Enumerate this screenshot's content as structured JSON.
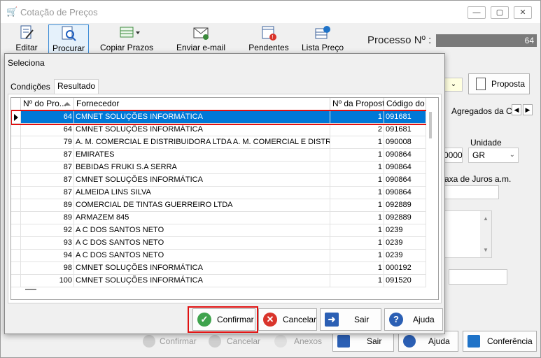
{
  "window": {
    "title": "Cotação de Preços",
    "controls": [
      "—",
      "▢",
      "✕"
    ]
  },
  "toolbar": {
    "buttons": [
      {
        "label": "Editar"
      },
      {
        "label": "Procurar"
      },
      {
        "label": "Copiar Prazos"
      },
      {
        "label": "Enviar e-mail"
      },
      {
        "label": "Pendentes"
      },
      {
        "label": "Lista Preço"
      }
    ],
    "process_label": "Processo Nº :",
    "process_value": "64"
  },
  "background": {
    "proposta_button": "Proposta",
    "agregados_tab": "Agregados da C",
    "unidade_label": "Unidade",
    "num_value": "0000",
    "unidade_value": "GR",
    "juros_label": "axa de Juros a.m.",
    "bottom_buttons": {
      "confirmar": "Confirmar",
      "cancelar": "Cancelar",
      "anexos": "Anexos",
      "sair": "Sair",
      "ajuda": "Ajuda",
      "conferencia": "Conferência"
    }
  },
  "dialog": {
    "title": "Seleciona",
    "tabs": [
      "Condições",
      "Resultado"
    ],
    "active_tab": "Resultado",
    "columns": [
      "Nº do Pro...",
      "Fornecedor",
      "Nº da Proposta",
      "Código do Iter"
    ],
    "rows": [
      {
        "num": "64",
        "fornecedor": "CMNET SOLUÇÕES INFORMÁTICA",
        "proposta": "1",
        "codigo": "091681"
      },
      {
        "num": "64",
        "fornecedor": "CMNET SOLUÇÕES INFORMÁTICA",
        "proposta": "2",
        "codigo": "091681"
      },
      {
        "num": "79",
        "fornecedor": "A. M. COMERCIAL E DISTRIBUIDORA LTDA A. M. COMERCIAL E DISTR",
        "proposta": "1",
        "codigo": "090008"
      },
      {
        "num": "87",
        "fornecedor": "EMIRATES",
        "proposta": "1",
        "codigo": "090864"
      },
      {
        "num": "87",
        "fornecedor": "BEBIDAS FRUKI S.A SERRA",
        "proposta": "1",
        "codigo": "090864"
      },
      {
        "num": "87",
        "fornecedor": "CMNET SOLUÇÕES INFORMÁTICA",
        "proposta": "1",
        "codigo": "090864"
      },
      {
        "num": "87",
        "fornecedor": "ALMEIDA LINS SILVA",
        "proposta": "1",
        "codigo": "090864"
      },
      {
        "num": "89",
        "fornecedor": "COMERCIAL DE TINTAS GUERREIRO LTDA",
        "proposta": "1",
        "codigo": "092889"
      },
      {
        "num": "89",
        "fornecedor": "ARMAZEM 845",
        "proposta": "1",
        "codigo": "092889"
      },
      {
        "num": "92",
        "fornecedor": "A C DOS SANTOS NETO",
        "proposta": "1",
        "codigo": "0239"
      },
      {
        "num": "93",
        "fornecedor": "A C DOS SANTOS NETO",
        "proposta": "1",
        "codigo": "0239"
      },
      {
        "num": "94",
        "fornecedor": "A C DOS SANTOS NETO",
        "proposta": "1",
        "codigo": "0239"
      },
      {
        "num": "98",
        "fornecedor": "CMNET SOLUÇÕES INFORMÁTICA",
        "proposta": "1",
        "codigo": "000192"
      },
      {
        "num": "100",
        "fornecedor": "CMNET SOLUÇÕES INFORMÁTICA",
        "proposta": "1",
        "codigo": "091520"
      }
    ],
    "buttons": {
      "confirmar": "Confirmar",
      "cancelar": "Cancelar",
      "sair": "Sair",
      "ajuda": "Ajuda"
    }
  },
  "colors": {
    "selection": "#0078d7",
    "highlight_outline": "#e01010",
    "confirm_green": "#3fa34d",
    "cancel_red": "#d9342b",
    "help_blue": "#2b5fb4"
  }
}
